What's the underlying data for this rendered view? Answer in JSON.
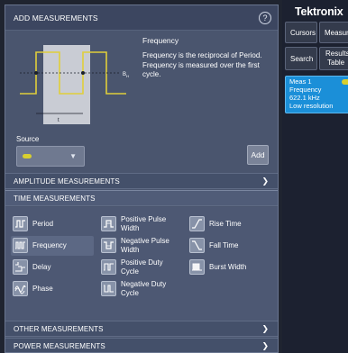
{
  "dialog": {
    "title": "ADD MEASUREMENTS",
    "help_icon": "?",
    "description_title": "Frequency",
    "description_text": "Frequency is the reciprocal of Period. Frequency is measured over the first cycle.",
    "preview_markers": {
      "level": "B",
      "level_sub": "H",
      "period": "t"
    },
    "source_label": "Source",
    "add_label": "Add",
    "colors": {
      "source_channel": "#d8cf2f",
      "accent": "#1b8fd8"
    }
  },
  "sections": {
    "amplitude": "AMPLITUDE MEASUREMENTS",
    "time": "TIME MEASUREMENTS",
    "other": "OTHER MEASUREMENTS",
    "power": "POWER MEASUREMENTS",
    "chevron": "❯"
  },
  "time_measurements": [
    {
      "label": "Period",
      "icon": "period-icon",
      "selected": false
    },
    {
      "label": "Frequency",
      "icon": "frequency-icon",
      "selected": true
    },
    {
      "label": "Delay",
      "icon": "delay-icon",
      "selected": false
    },
    {
      "label": "Phase",
      "icon": "phase-icon",
      "selected": false
    },
    {
      "label": "Positive Pulse Width",
      "line1": "Positive Pulse",
      "line2": "Width",
      "icon": "positive-pulse-width-icon"
    },
    {
      "label": "Negative Pulse Width",
      "line1": "Negative Pulse",
      "line2": "Width",
      "icon": "negative-pulse-width-icon"
    },
    {
      "label": "Positive Duty Cycle",
      "line1": "Positive Duty",
      "line2": "Cycle",
      "icon": "positive-duty-cycle-icon"
    },
    {
      "label": "Negative Duty Cycle",
      "line1": "Negative Duty",
      "line2": "Cycle",
      "icon": "negative-duty-cycle-icon"
    },
    {
      "label": "Rise Time",
      "icon": "rise-time-icon"
    },
    {
      "label": "Fall Time",
      "icon": "fall-time-icon"
    },
    {
      "label": "Burst Width",
      "icon": "burst-width-icon"
    }
  ],
  "side_panel": {
    "brand": "Tektronix",
    "cursors": "Cursors",
    "measure": "Measure",
    "search": "Search",
    "results_line1": "Results",
    "results_line2": "Table",
    "badge": {
      "title": "Meas 1",
      "name": "Frequency",
      "value": "622.1 kHz",
      "status": "Low resolution"
    }
  }
}
